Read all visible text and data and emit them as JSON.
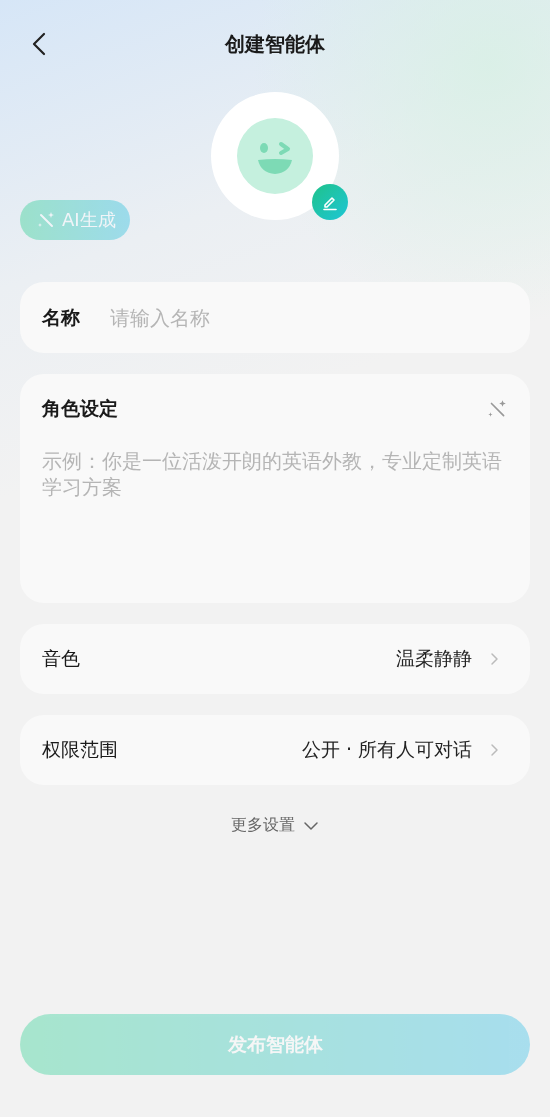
{
  "header": {
    "title": "创建智能体"
  },
  "ai_generate": {
    "label": "AI生成",
    "disabled": true
  },
  "name_field": {
    "label": "名称",
    "placeholder": "请输入名称"
  },
  "role_field": {
    "label": "角色设定",
    "placeholder": "示例：你是一位活泼开朗的英语外教，专业定制英语学习方案"
  },
  "settings": [
    {
      "label": "音色",
      "value": "温柔静静"
    },
    {
      "label": "权限范围",
      "value": "公开 · 所有人可对话"
    }
  ],
  "more_settings": {
    "label": "更多设置",
    "expanded": false
  },
  "publish": {
    "label": "发布智能体",
    "disabled": true
  }
}
